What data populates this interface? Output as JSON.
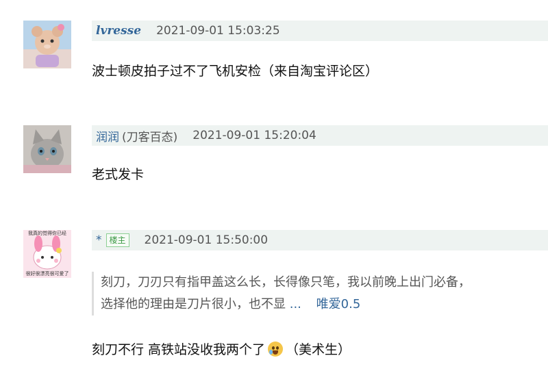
{
  "comments": [
    {
      "username": "lvresse",
      "group": "",
      "time": "2021-09-01 15:03:25",
      "text": "波士顿皮拍子过不了飞机安检（来自淘宝评论区）"
    },
    {
      "username": "润润",
      "group": "(刀客百态)",
      "time": "2021-09-01 15:20:04",
      "text": "老式发卡"
    },
    {
      "username": "*",
      "op_tag": "楼主",
      "time": "2021-09-01 15:50:00",
      "quote_line1": "刻刀，刀刃只有指甲盖这么长，长得像只笔，我以前晚上出门必备，",
      "quote_line2": "选择他的理由是刀片很小，也不显",
      "quote_more": "...",
      "quote_like": "唯爱0.5",
      "text_before": "刻刀不行 高铁站没收我两个了",
      "text_after": "（美术生）",
      "avatar_text_top": "我真的觉得你已经",
      "avatar_text_bottom": "很好很漂亮很可爱了"
    }
  ],
  "icons": {
    "emoji": "crying-face-emoji"
  },
  "colors": {
    "meta_bg": "#eef3f1",
    "link": "#336699",
    "op_tag": "#3c9a46"
  }
}
